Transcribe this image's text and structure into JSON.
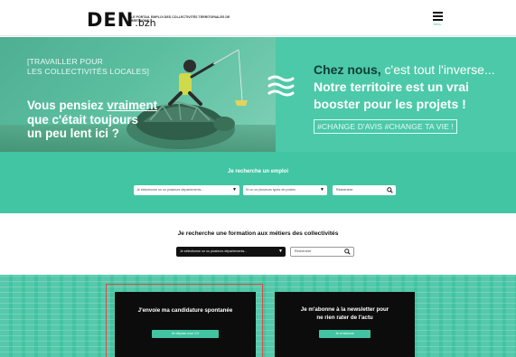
{
  "header": {
    "logo_text": "DEN",
    "logo_suffix": ".bzh",
    "tagline": "Le portail emploi des collectivités territoriales de Bretagne",
    "menu_label": "Menu"
  },
  "hero": {
    "kicker_line1": "[TRAVAILLER POUR",
    "kicker_line2": "LES COLLECTIVITÉS LOCALES]",
    "title_line1_a": "Vous pensiez ",
    "title_line1_b": "vraiment",
    "title_line2": "que c'était toujours",
    "title_line3": "un peu lent ici ?",
    "right_line1_bold": "Chez nous,",
    "right_line1_rest": " c'est tout l'inverse...",
    "right_line2": "Notre territoire est un vrai",
    "right_line3": "booster pour les projets !",
    "hashtags": "#CHANGE D'AVIS #CHANGE TA VIE !"
  },
  "jobs": {
    "title": "Je recherche un emploi",
    "departments_placeholder": "Je sélectionne un ou plusieurs départements...",
    "types_placeholder": "Et un ou plusieurs types de postes",
    "search_placeholder": "Rechercher"
  },
  "training": {
    "title": "Je recherche une formation aux métiers des collectivités",
    "departments_placeholder": "Je sélectionne un ou plusieurs départements...",
    "search_placeholder": "Rechercher"
  },
  "cards": {
    "application_title": "J'envoie ma candidature spontanée",
    "application_button": "Je dépose mon CV",
    "newsletter_title_line1": "Je m'abonne à la newsletter pour",
    "newsletter_title_line2": "ne rien rater de l'actu",
    "newsletter_button": "Je m'abonne"
  },
  "colors": {
    "brand_green": "#42c5a3",
    "dark": "#0c0c0c",
    "highlight_red": "#d94b43"
  }
}
